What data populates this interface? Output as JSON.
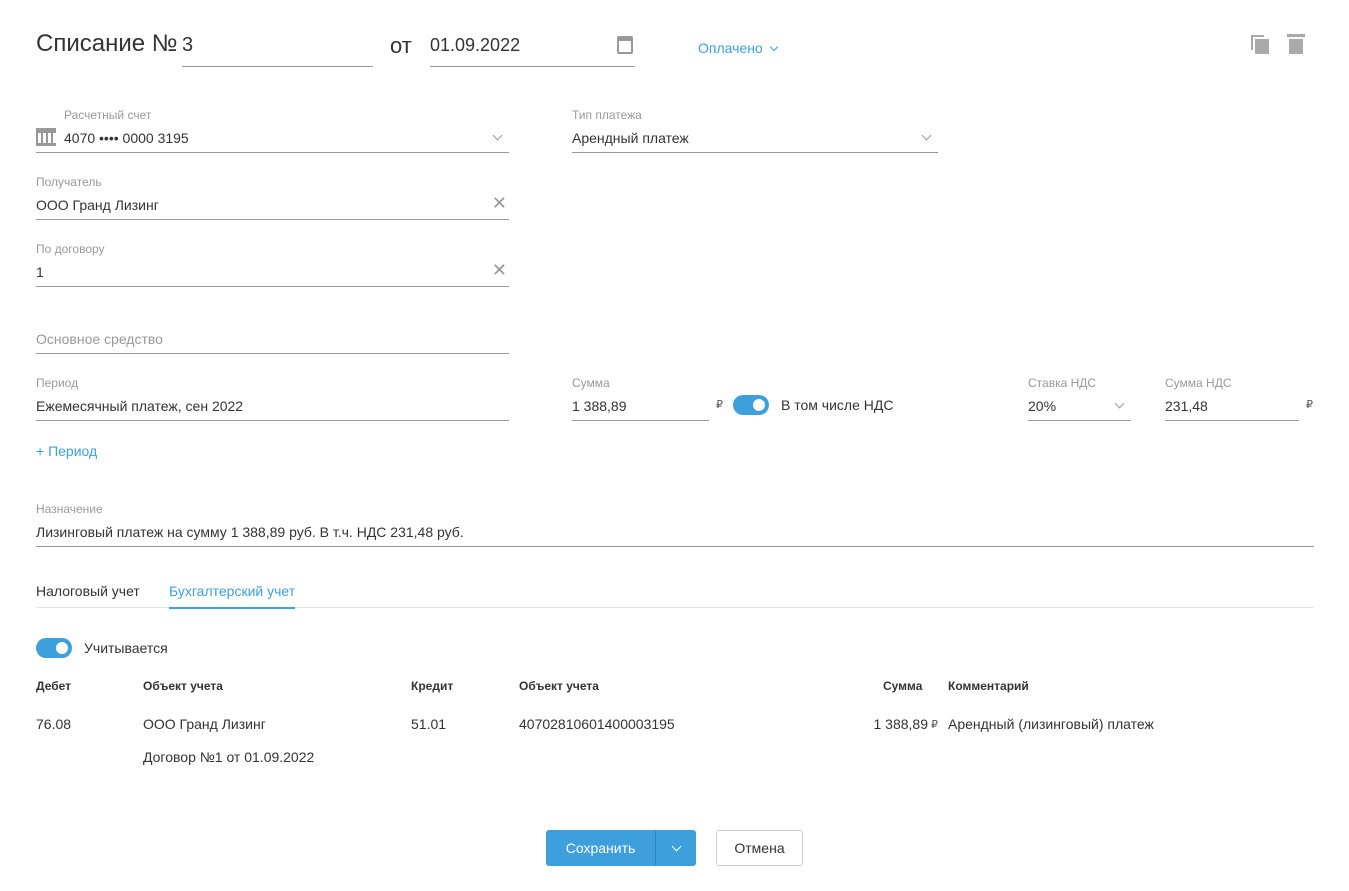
{
  "header": {
    "title": "Списание №",
    "number": "3",
    "from": "от",
    "date": "01.09.2022",
    "status": "Оплачено"
  },
  "account": {
    "label": "Расчетный счет",
    "value": "4070 •••• 0000 3195"
  },
  "payment_type": {
    "label": "Тип платежа",
    "value": "Арендный платеж"
  },
  "recipient": {
    "label": "Получатель",
    "value": "ООО Гранд Лизинг"
  },
  "contract": {
    "label": "По договору",
    "value": "1"
  },
  "asset": {
    "placeholder": "Основное средство"
  },
  "period": {
    "label": "Период",
    "value": "Ежемесячный платеж, сен 2022",
    "add": "+ Период"
  },
  "sum": {
    "label": "Сумма",
    "value": "1 388,89",
    "currency": "₽",
    "vat_toggle": "В том числе НДС",
    "vat_on": true
  },
  "vat_rate": {
    "label": "Ставка НДС",
    "value": "20%"
  },
  "vat_sum": {
    "label": "Сумма НДС",
    "value": "231,48",
    "currency": "₽"
  },
  "purpose": {
    "label": "Назначение",
    "value": "Лизинговый платеж на сумму 1 388,89 руб. В т.ч. НДС 231,48 руб."
  },
  "tabs": [
    {
      "label": "Налоговый учет"
    },
    {
      "label": "Бухгалтерский учет",
      "active": true
    }
  ],
  "accounted": {
    "label": "Учитывается",
    "on": true
  },
  "table": {
    "headers": [
      "Дебет",
      "Объект учета",
      "Кредит",
      "Объект учета",
      "Сумма",
      "Комментарий"
    ],
    "row": {
      "debit": "76.08",
      "debit_obj": "ООО Гранд Лизинг",
      "debit_obj2": "Договор №1 от 01.09.2022",
      "credit": "51.01",
      "credit_obj": "40702810601400003195",
      "sum": "1 388,89",
      "currency": "₽",
      "comment": "Арендный (лизинговый) платеж"
    }
  },
  "buttons": {
    "save": "Сохранить",
    "cancel": "Отмена"
  },
  "colors": {
    "accent": "#3d9fdc"
  }
}
